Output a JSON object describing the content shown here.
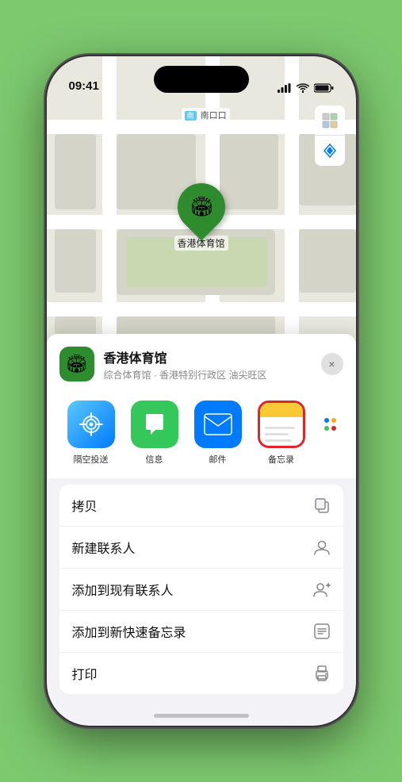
{
  "status_bar": {
    "time": "09:41",
    "location_arrow": true
  },
  "map": {
    "label_south_entrance": "南口",
    "label_prefix": "南口"
  },
  "map_pin": {
    "label": "香港体育馆"
  },
  "map_controls": {
    "map_icon": "🗺",
    "location_icon": "➤"
  },
  "sheet": {
    "venue_name": "香港体育馆",
    "venue_sub": "综合体育馆 · 香港特别行政区 油尖旺区",
    "close_label": "×"
  },
  "app_icons": [
    {
      "id": "airdrop",
      "label": "隔空投送",
      "highlighted": false
    },
    {
      "id": "messages",
      "label": "信息",
      "highlighted": false
    },
    {
      "id": "mail",
      "label": "邮件",
      "highlighted": false
    },
    {
      "id": "notes",
      "label": "备忘录",
      "highlighted": true
    }
  ],
  "menu_items": [
    {
      "label": "拷贝",
      "icon": "copy"
    },
    {
      "label": "新建联系人",
      "icon": "person"
    },
    {
      "label": "添加到现有联系人",
      "icon": "person-add"
    },
    {
      "label": "添加到新快速备忘录",
      "icon": "note"
    },
    {
      "label": "打印",
      "icon": "printer"
    }
  ]
}
